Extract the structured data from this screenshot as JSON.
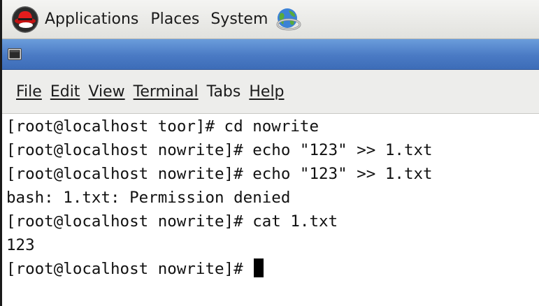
{
  "panel": {
    "applications_label": "Applications",
    "places_label": "Places",
    "system_label": "System",
    "logo_icon": "redhat-logo-icon",
    "network_icon": "network-globe-icon"
  },
  "window": {
    "icon": "terminal-icon",
    "title": ""
  },
  "menu": {
    "file": "File",
    "edit": "Edit",
    "view": "View",
    "terminal": "Terminal",
    "tabs": "Tabs",
    "help": "Help"
  },
  "terminal": {
    "lines": [
      "[root@localhost toor]# cd nowrite",
      "[root@localhost nowrite]# echo \"123\" >> 1.txt",
      "[root@localhost nowrite]# echo \"123\" >> 1.txt",
      "bash: 1.txt: Permission denied",
      "[root@localhost nowrite]# cat 1.txt",
      "123"
    ],
    "prompt": "[root@localhost nowrite]# "
  },
  "colors": {
    "titlebar_blue": "#4a7ac4",
    "panel_bg": "#ededeb",
    "terminal_bg": "#ffffff",
    "terminal_fg": "#111111"
  }
}
